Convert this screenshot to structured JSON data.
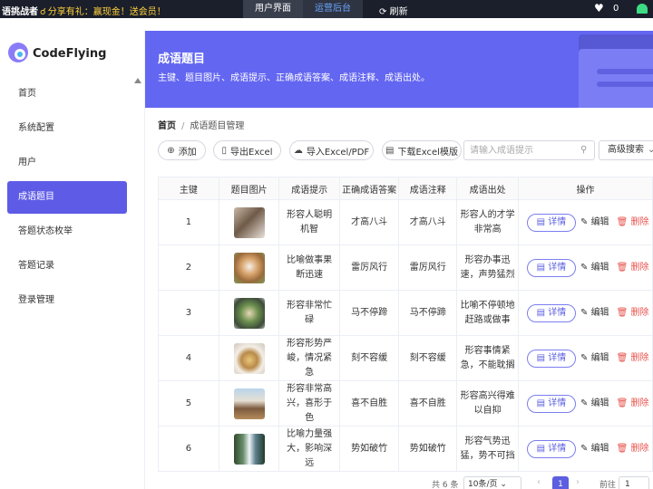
{
  "topbar": {
    "brand": "语挑战者",
    "share_text": "分享有礼：赢现金！送会员！",
    "tab_user": "用户界面",
    "tab_admin": "运营后台",
    "refresh_label": "刷新",
    "likes": "0"
  },
  "sidebar": {
    "logo_text": "CodeFlying",
    "items": [
      {
        "label": "首页"
      },
      {
        "label": "系统配置"
      },
      {
        "label": "用户"
      },
      {
        "label": "成语题目"
      },
      {
        "label": "答题状态枚举"
      },
      {
        "label": "答题记录"
      },
      {
        "label": "登录管理"
      }
    ],
    "active_index": 3
  },
  "banner": {
    "title": "成语题目",
    "description": "主键、题目图片、成语提示、正确成语答案、成语注释、成语出处。"
  },
  "breadcrumb": {
    "home": "首页",
    "current": "成语题目管理"
  },
  "toolbar": {
    "add": "添加",
    "export_excel": "导出Excel",
    "import": "导入Excel/PDF",
    "download_template": "下载Excel模版",
    "search_placeholder": "请输入成语提示",
    "advanced_search": "高级搜索"
  },
  "table": {
    "headers": [
      "主键",
      "题目图片",
      "成语提示",
      "正确成语答案",
      "成语注释",
      "成语出处",
      "操作"
    ],
    "action_detail": "详情",
    "action_edit": "编辑",
    "action_delete": "删除",
    "rows": [
      {
        "id": "1",
        "image": "hands-writing",
        "hint": "形容人聪明机智",
        "answer": "才高八斗",
        "note": "才高八斗",
        "source": "形容人的才学非常高"
      },
      {
        "id": "2",
        "image": "puppy-dog",
        "hint": "比喻做事果断迅速",
        "answer": "雷厉风行",
        "note": "雷厉风行",
        "source": "形容办事迅速，声势猛烈"
      },
      {
        "id": "3",
        "image": "food-bowl",
        "hint": "形容非常忙碌",
        "answer": "马不停蹄",
        "note": "马不停蹄",
        "source": "比喻不停顿地赶路或做事"
      },
      {
        "id": "4",
        "image": "soup-bowl",
        "hint": "形容形势严峻，情况紧急",
        "answer": "刻不容缓",
        "note": "刻不容缓",
        "source": "形容事情紧急，不能耽搁"
      },
      {
        "id": "5",
        "image": "person-outdoors",
        "hint": "形容非常高兴，喜形于色",
        "answer": "喜不自胜",
        "note": "喜不自胜",
        "source": "形容高兴得难以自抑"
      },
      {
        "id": "6",
        "image": "waterfall",
        "hint": "比喻力量强大，影响深远",
        "answer": "势如破竹",
        "note": "势如破竹",
        "source": "形容气势迅猛，势不可挡"
      }
    ]
  },
  "pagination": {
    "total_text": "共 6 条",
    "page_size": "10条/页",
    "current_page": "1",
    "goto_label": "前往",
    "goto_value": "1"
  },
  "colors": {
    "primary": "#5e5ce6",
    "banner": "#6366f1",
    "topbar": "#1b1f2b",
    "share": "#ffd23c",
    "delete": "#e8514b"
  }
}
